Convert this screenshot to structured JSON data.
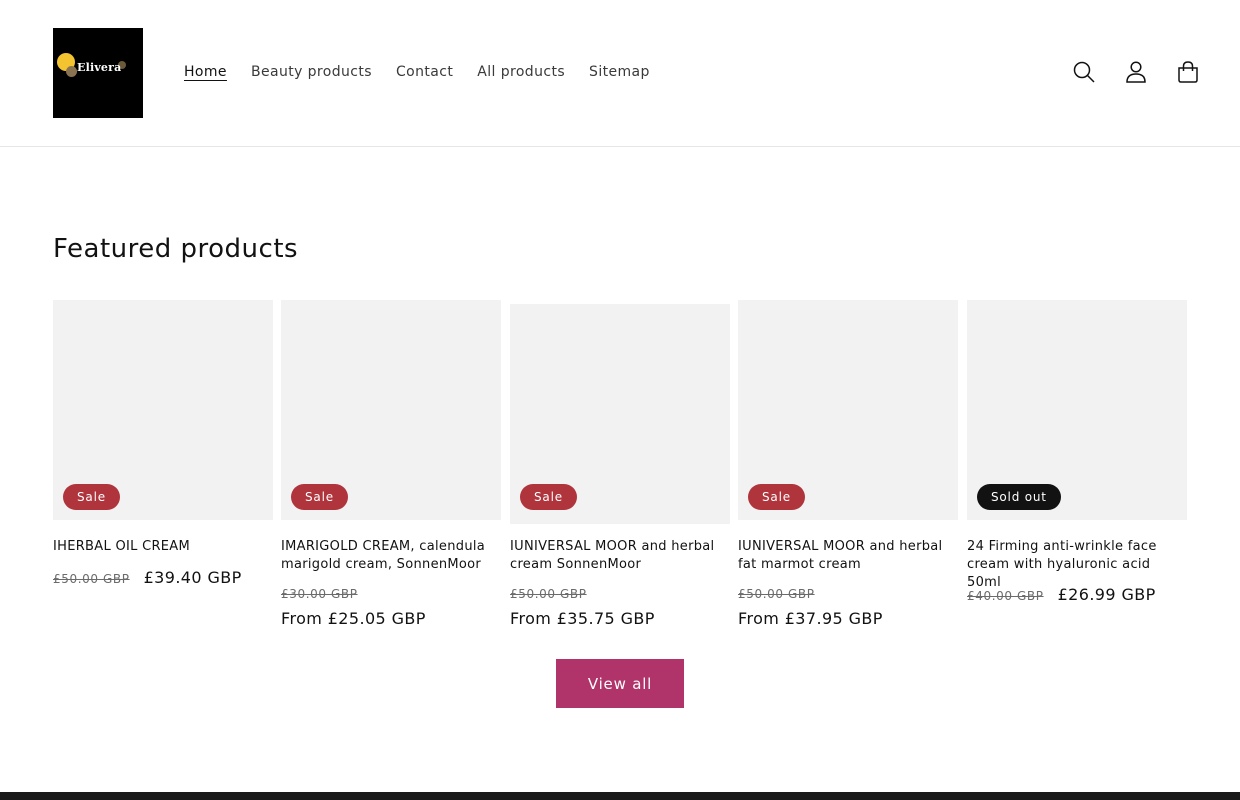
{
  "logo": {
    "text": "Elivera"
  },
  "nav": {
    "items": [
      {
        "label": "Home",
        "active": true
      },
      {
        "label": "Beauty products"
      },
      {
        "label": "Contact"
      },
      {
        "label": "All products"
      },
      {
        "label": "Sitemap"
      }
    ]
  },
  "header_icons": [
    "search-icon",
    "account-icon",
    "cart-icon"
  ],
  "featured": {
    "title": "Featured products",
    "products": [
      {
        "title": "IHERBAL OIL CREAM",
        "badge": "Sale",
        "price_old": "£50.00 GBP",
        "price_new": "£39.40 GBP"
      },
      {
        "title": "IMARIGOLD CREAM, calendula marigold cream, SonnenMoor",
        "badge": "Sale",
        "price_old": "£30.00 GBP",
        "price_from": "From £25.05 GBP"
      },
      {
        "title": "IUNIVERSAL MOOR and herbal cream SonnenMoor",
        "badge": "Sale",
        "price_old": "£50.00 GBP",
        "price_from": "From £35.75 GBP"
      },
      {
        "title": "IUNIVERSAL MOOR and herbal fat marmot cream",
        "badge": "Sale",
        "price_old": "£50.00 GBP",
        "price_from": "From £37.95 GBP"
      },
      {
        "title": "24 Firming anti-wrinkle face cream with hyaluronic acid 50ml",
        "badge": "Sold out",
        "price_old": "£40.00 GBP",
        "price_new": "£26.99 GBP"
      }
    ],
    "view_all": "View all"
  },
  "colors": {
    "sale_badge": "#b0343c",
    "sold_badge": "#121212",
    "button": "#b0336a",
    "media_bg": "#f2f2f2"
  }
}
